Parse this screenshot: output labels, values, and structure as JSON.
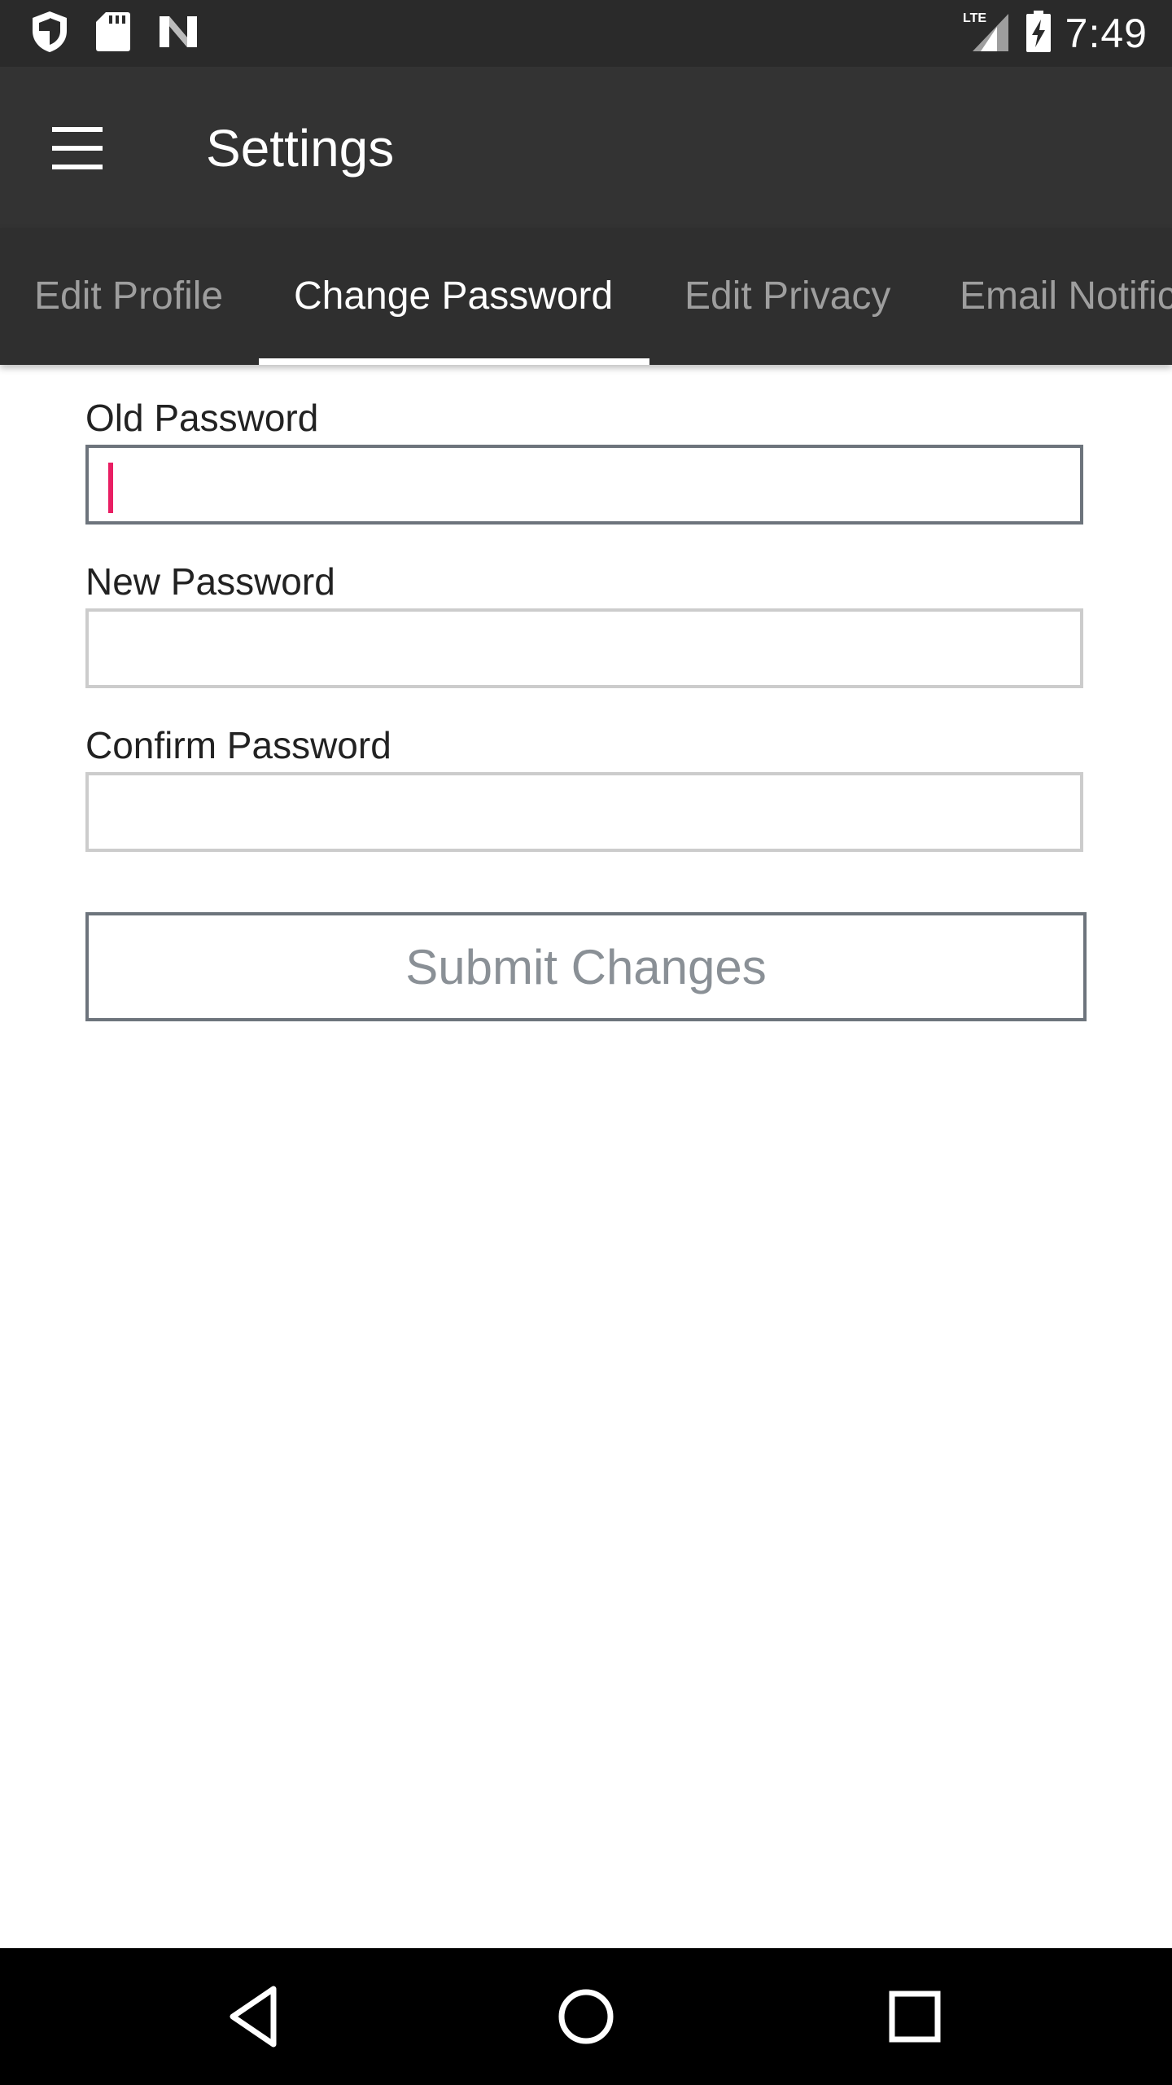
{
  "status_bar": {
    "time": "7:49",
    "network": "LTE",
    "left_icons": [
      "shield-icon",
      "sd-card-icon",
      "notification-n-icon"
    ],
    "right_icons": [
      "signal-icon",
      "battery-charging-icon"
    ]
  },
  "app_bar": {
    "title": "Settings",
    "menu_icon": "hamburger-menu-icon"
  },
  "tabs": [
    {
      "label": "Edit Profile",
      "active": false
    },
    {
      "label": "Change Password",
      "active": true
    },
    {
      "label": "Edit Privacy",
      "active": false
    },
    {
      "label": "Email Notific",
      "active": false
    }
  ],
  "form": {
    "old_password": {
      "label": "Old Password",
      "value": "",
      "placeholder": ""
    },
    "new_password": {
      "label": "New Password",
      "value": "",
      "placeholder": ""
    },
    "confirm_password": {
      "label": "Confirm Password",
      "value": "",
      "placeholder": ""
    },
    "submit_label": "Submit Changes"
  },
  "nav_bar": {
    "icons": [
      "back-icon",
      "home-icon",
      "recents-icon"
    ]
  },
  "colors": {
    "status_bar": "#2a2a2a",
    "app_bar": "#333333",
    "tab_bar": "#2f2f2f",
    "caret": "#e91e63",
    "button_border": "#6d747c"
  }
}
